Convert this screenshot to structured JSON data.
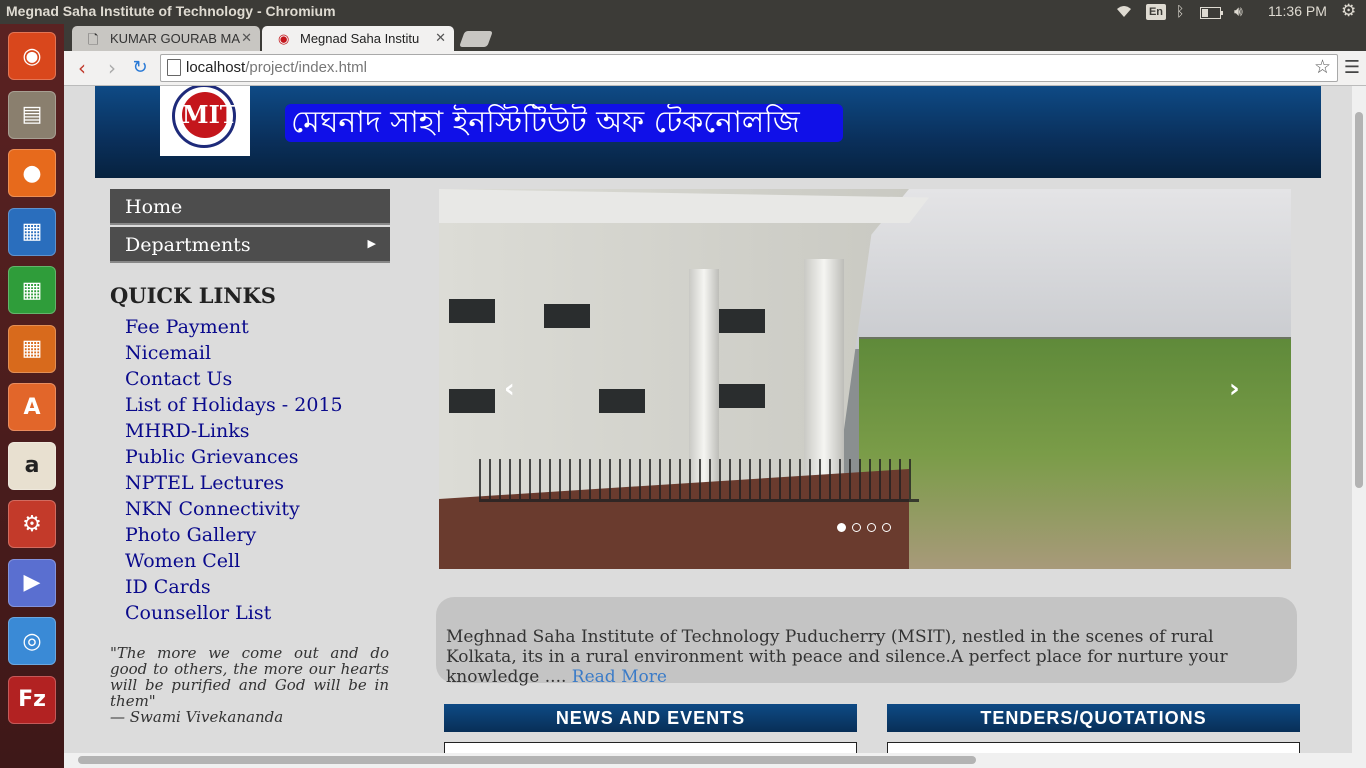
{
  "os_panel": {
    "window_title": "Megnad Saha Institute of Technology - Chromium",
    "keyboard_layout": "En",
    "clock": "11:36 PM"
  },
  "launcher": {
    "items": [
      {
        "name": "ubuntu-dash",
        "glyph": "◉",
        "color": "#d9471c"
      },
      {
        "name": "files",
        "glyph": "▤",
        "color": "#8a7f6e"
      },
      {
        "name": "firefox",
        "glyph": "●",
        "color": "#e76a1c"
      },
      {
        "name": "writer",
        "glyph": "▦",
        "color": "#2a6ebd"
      },
      {
        "name": "calc",
        "glyph": "▦",
        "color": "#2f9d3a"
      },
      {
        "name": "impress",
        "glyph": "▦",
        "color": "#d86a1c"
      },
      {
        "name": "software-center",
        "glyph": "A",
        "color": "#e2662a"
      },
      {
        "name": "amazon",
        "glyph": "a",
        "color": "#e8e0d0"
      },
      {
        "name": "system-settings",
        "glyph": "⚙",
        "color": "#c33a2a"
      },
      {
        "name": "videos",
        "glyph": "▶",
        "color": "#5a6fd0"
      },
      {
        "name": "chromium",
        "glyph": "◎",
        "color": "#3a8ad6"
      },
      {
        "name": "filezilla",
        "glyph": "Fz",
        "color": "#b22222"
      }
    ]
  },
  "browser": {
    "tabs": [
      {
        "title": "KUMAR GOURAB MA",
        "favicon": "page-icon"
      },
      {
        "title": "Megnad Saha Institu",
        "favicon": "site-logo-icon"
      }
    ],
    "url_host": "localhost",
    "url_path": "/project/index.html"
  },
  "site": {
    "logo_text": "MIT",
    "banner_bengali": "মেঘনাদ সাহা ইনস্টিটিউট অফ টেকনোলজি",
    "menu": [
      {
        "label": "Home"
      },
      {
        "label": "Departments"
      }
    ],
    "quick_links_title": "QUICK LINKS",
    "quick_links": [
      "Fee Payment",
      "Nicemail",
      "Contact Us",
      "List of Holidays - 2015",
      "MHRD-Links",
      "Public Grievances",
      "NPTEL Lectures",
      "NKN Connectivity",
      "Photo Gallery",
      "Women Cell",
      "ID Cards",
      "Counsellor List"
    ],
    "quote": "\"The more we come out and do good to others, the more our hearts will be purified and God will be in them\"",
    "quote_author": "— Swami Vivekananda",
    "slider": {
      "prev": "‹",
      "next": "›",
      "slide_count": 4,
      "active_slide": 1
    },
    "about_text": "Meghnad Saha Institute of Technology Puducherry (MSIT), nestled in the scenes of rural Kolkata, its in a rural environment with peace and silence.A perfect place for nurture your knowledge .... ",
    "read_more": "Read More",
    "news_title": "NEWS AND EVENTS",
    "tenders_title": "TENDERS/QUOTATIONS"
  }
}
